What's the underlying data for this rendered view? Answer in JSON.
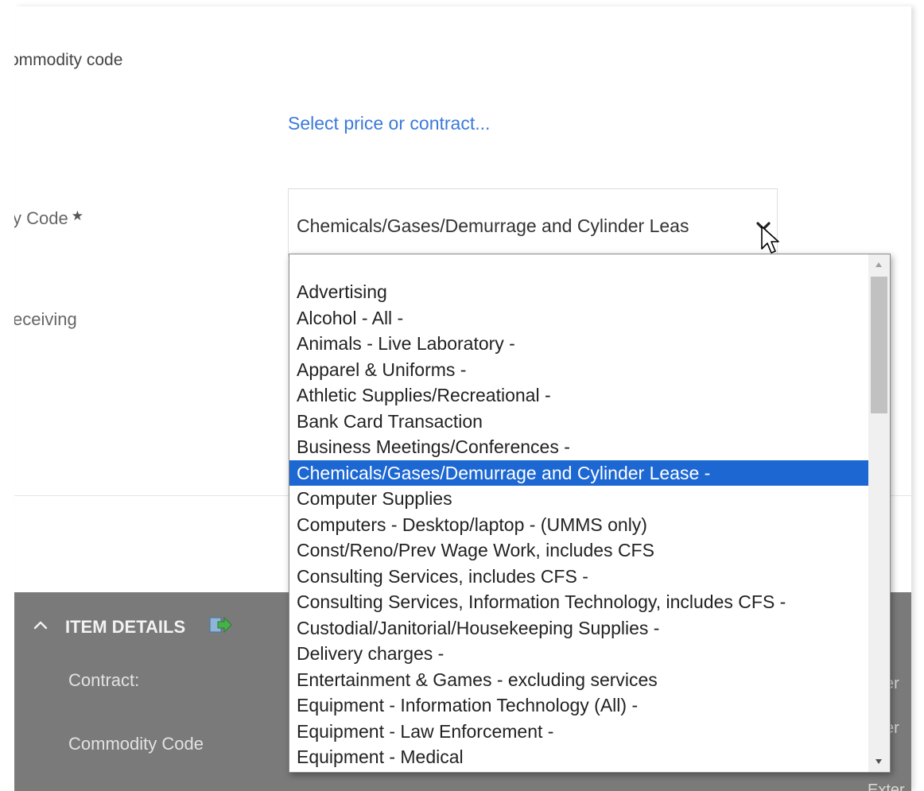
{
  "form": {
    "commodity_code_label": "ommodity code",
    "price_contract_link": "Select price or contract...",
    "commodity_code_field_label": "y Code",
    "required_marker": "★",
    "receiving_label": "eceiving",
    "commodity_select_value": "Chemicals/Gases/Demurrage and Cylinder Leas"
  },
  "item_details": {
    "title": "ITEM DETAILS",
    "contract_label": "Contract:",
    "commodity_code_label": "Commodity Code",
    "ext_1": "er",
    "ext_2": "er",
    "ext_3": "Exter"
  },
  "dropdown": {
    "options": [
      "",
      "Advertising",
      "Alcohol - All -",
      "Animals - Live Laboratory -",
      "Apparel & Uniforms -",
      "Athletic Supplies/Recreational -",
      "Bank Card Transaction",
      "Business Meetings/Conferences -",
      "Chemicals/Gases/Demurrage and Cylinder Lease -",
      "Computer Supplies",
      "Computers - Desktop/laptop - (UMMS only)",
      "Const/Reno/Prev Wage Work, includes CFS",
      "Consulting Services, includes CFS -",
      "Consulting Services, Information Technology, includes CFS -",
      "Custodial/Janitorial/Housekeeping Supplies -",
      "Delivery charges -",
      "Entertainment & Games - excluding services",
      "Equipment - Information Technology (All) -",
      "Equipment - Law Enforcement -",
      "Equipment - Medical"
    ],
    "selected_index": 8
  },
  "icons": {
    "select_chevron": "chevron-down-icon",
    "section_toggle": "chevron-up-icon",
    "export": "export-arrow-icon",
    "cursor": "mouse-pointer-icon"
  },
  "colors": {
    "link": "#3b7ad9",
    "selection": "#1c67d2",
    "panel": "#7a7a7a"
  }
}
